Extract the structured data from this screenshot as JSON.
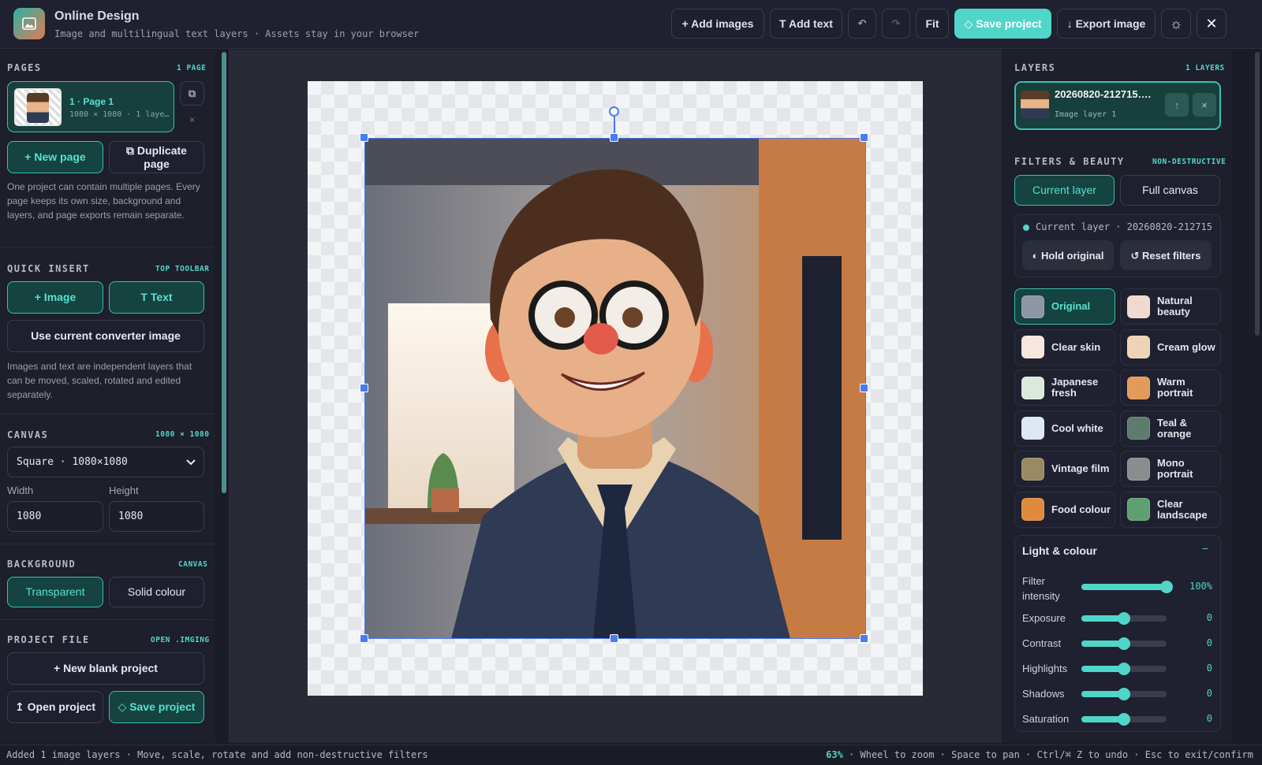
{
  "header": {
    "title": "Online Design",
    "subtitle": "Image and multilingual text layers · Assets stay in your browser",
    "add_images": "+ Add images",
    "add_text": "T Add text",
    "undo": "↶",
    "redo": "↷",
    "fit": "Fit",
    "save": "◇ Save project",
    "export": "↓ Export image",
    "theme_icon": "☼",
    "close": "✕"
  },
  "pages": {
    "title": "PAGES",
    "tag": "1 PAGE",
    "page_name": "1 · Page 1",
    "page_meta": "1080 × 1080 · 1 laye…",
    "copy_icon": "⧉",
    "remove_icon": "×",
    "new_page": "+ New page",
    "duplicate": "⧉ Duplicate page",
    "help": "One project can contain multiple pages. Every page keeps its own size, background and layers, and page exports remain separate."
  },
  "quick": {
    "title": "QUICK INSERT",
    "tag": "TOP TOOLBAR",
    "image": "+ Image",
    "text": "T Text",
    "converter": "Use current converter image",
    "help": "Images and text are independent layers that can be moved, scaled, rotated and edited separately."
  },
  "canvas": {
    "title": "CANVAS",
    "tag": "1080 × 1080",
    "preset": "Square · 1080×1080",
    "width_label": "Width",
    "height_label": "Height",
    "width": "1080",
    "height": "1080"
  },
  "background": {
    "title": "BACKGROUND",
    "tag": "CANVAS",
    "transparent": "Transparent",
    "solid": "Solid colour"
  },
  "project": {
    "title": "PROJECT FILE",
    "tag": "OPEN .IMGING",
    "new_blank": "+ New blank project",
    "open": "↥ Open project",
    "save": "◇ Save project"
  },
  "layers": {
    "title": "LAYERS",
    "tag": "1 LAYERS",
    "name": "20260820-212715….",
    "sub": "Image layer 1",
    "up": "↑",
    "remove": "×"
  },
  "filters": {
    "title": "FILTERS & BEAUTY",
    "tag": "NON-DESTRUCTIVE",
    "current_layer": "Current layer",
    "full_canvas": "Full canvas",
    "target": "Current layer · 20260820-212715",
    "hold": "◐ Hold original",
    "reset": "↺ Reset filters",
    "presets": [
      {
        "label": "Original",
        "color": "#8e96a6"
      },
      {
        "label": "Natural beauty",
        "color": "#f2d9cf"
      },
      {
        "label": "Clear skin",
        "color": "#f6e6dc"
      },
      {
        "label": "Cream glow",
        "color": "#efd3b6"
      },
      {
        "label": "Japanese fresh",
        "color": "#dce8dc"
      },
      {
        "label": "Warm portrait",
        "color": "#e39a5a"
      },
      {
        "label": "Cool white",
        "color": "#dce9f2"
      },
      {
        "label": "Teal & orange",
        "color": "#5e7c6c"
      },
      {
        "label": "Vintage film",
        "color": "#9a8a64"
      },
      {
        "label": "Mono portrait",
        "color": "#8a8c90"
      },
      {
        "label": "Food colour",
        "color": "#e08a3e"
      },
      {
        "label": "Clear landscape",
        "color": "#5fa070"
      }
    ],
    "light_title": "Light & colour",
    "collapse": "−",
    "sliders": [
      {
        "label": "Filter intensity",
        "value": "100%",
        "level": 1.0
      },
      {
        "label": "Exposure",
        "value": "0",
        "level": 0.5
      },
      {
        "label": "Contrast",
        "value": "0",
        "level": 0.5
      },
      {
        "label": "Highlights",
        "value": "0",
        "level": 0.5
      },
      {
        "label": "Shadows",
        "value": "0",
        "level": 0.5
      },
      {
        "label": "Saturation",
        "value": "0",
        "level": 0.5
      }
    ]
  },
  "status": {
    "left": "Added 1 image layers · Move, scale, rotate and add non-destructive filters",
    "zoom": "63%",
    "right": " · Wheel to zoom · Space to pan · Ctrl/⌘ Z to undo · Esc to exit/confirm"
  },
  "colors": {
    "accent": "#4fd6c8",
    "selection": "#4a7bf0"
  }
}
